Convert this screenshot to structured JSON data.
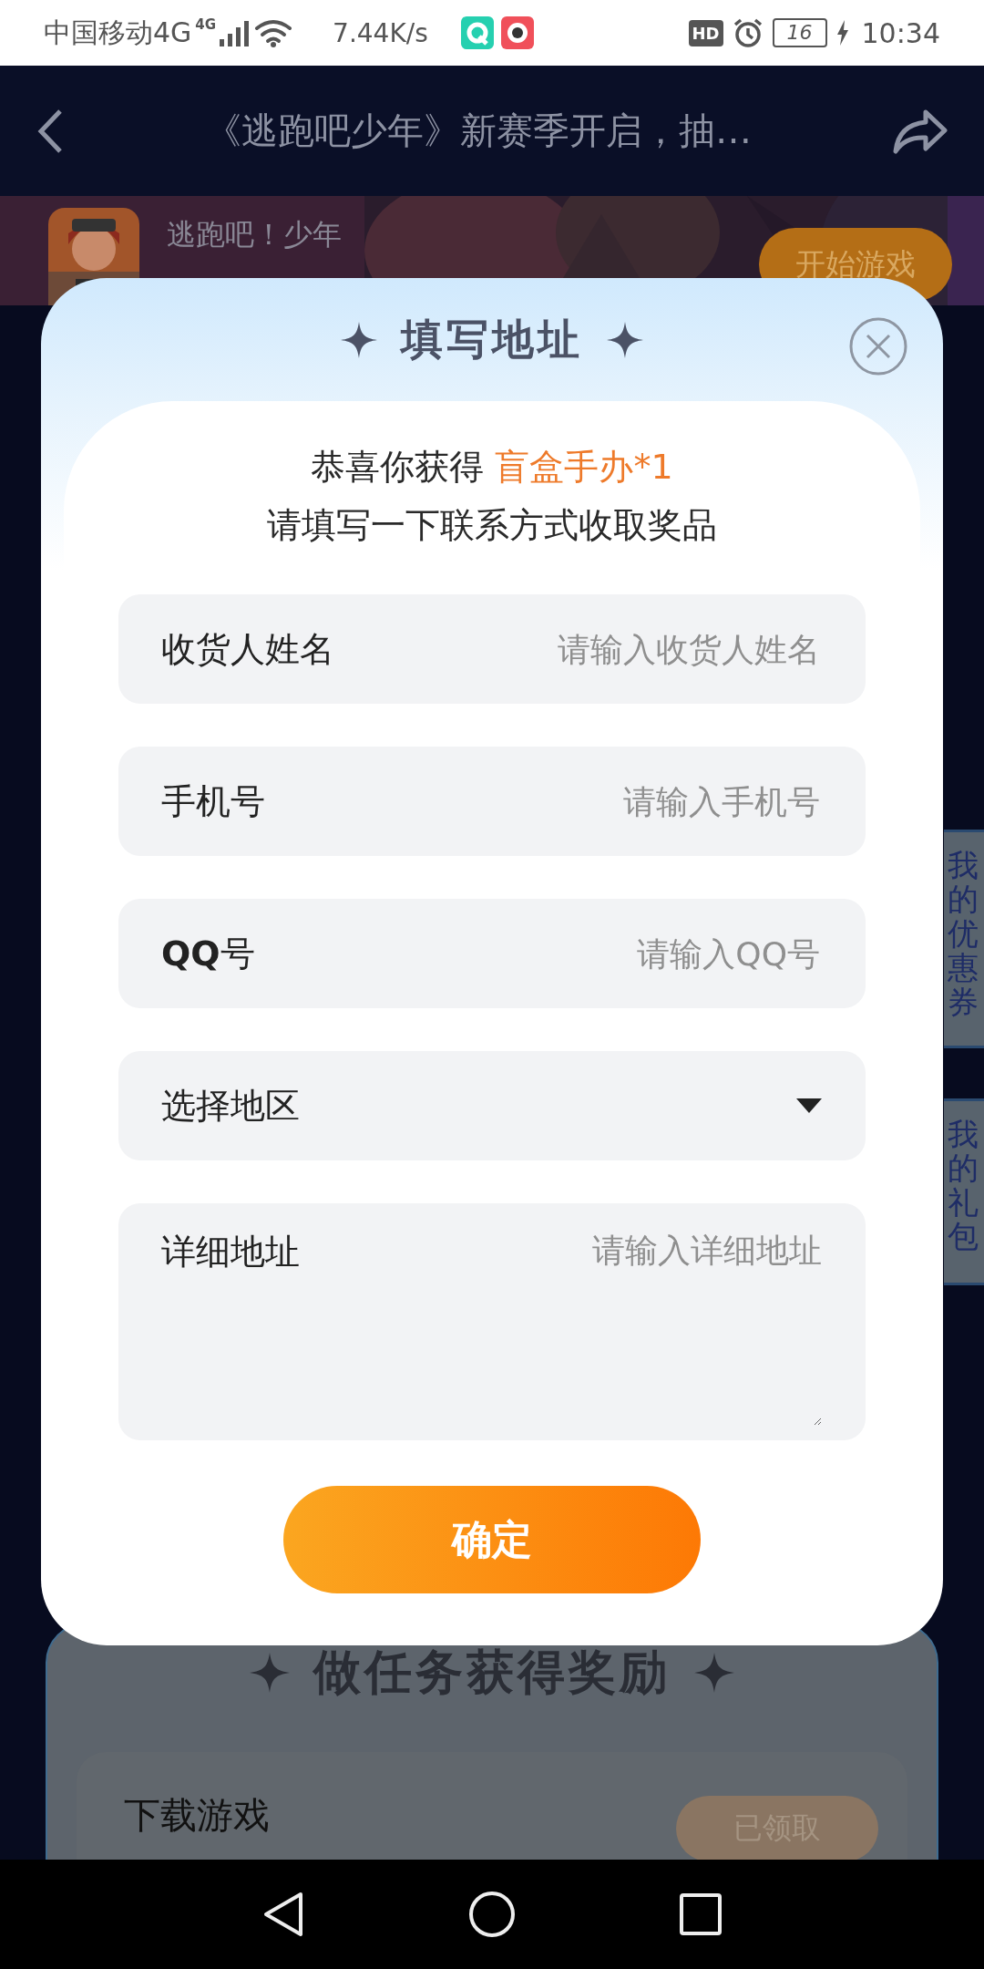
{
  "status_bar": {
    "carrier": "中国移动4G",
    "network": "4G",
    "speed": "7.44K/s",
    "hd": "HD",
    "battery": "16",
    "time": "10:34"
  },
  "header": {
    "title": "《逃跑吧少年》新赛季开启，抽…"
  },
  "game": {
    "name": "逃跑吧！少年",
    "button": "开始游戏"
  },
  "side_tabs": [
    {
      "label": "我的优惠券"
    },
    {
      "label": "我的礼包"
    }
  ],
  "tasks": {
    "title": "做任务获得奖励",
    "items": [
      {
        "name": "下载游戏",
        "button": "已领取"
      }
    ]
  },
  "dialog": {
    "title": "填写地址",
    "congrats": "恭喜你获得",
    "prize": "盲盒手办*1",
    "instruction": "请填写一下联系方式收取奖品",
    "fields": [
      {
        "kind": "input",
        "label": "收货人姓名",
        "placeholder": "请输入收货人姓名"
      },
      {
        "kind": "input",
        "label": "手机号",
        "placeholder": "请输入手机号"
      },
      {
        "kind": "input",
        "label": "**QQ**号",
        "placeholder": "请输入QQ号"
      },
      {
        "kind": "select",
        "label": "选择地区"
      },
      {
        "kind": "textarea",
        "label": "详细地址",
        "placeholder": "请输入详细地址"
      }
    ],
    "confirm": "确定"
  }
}
